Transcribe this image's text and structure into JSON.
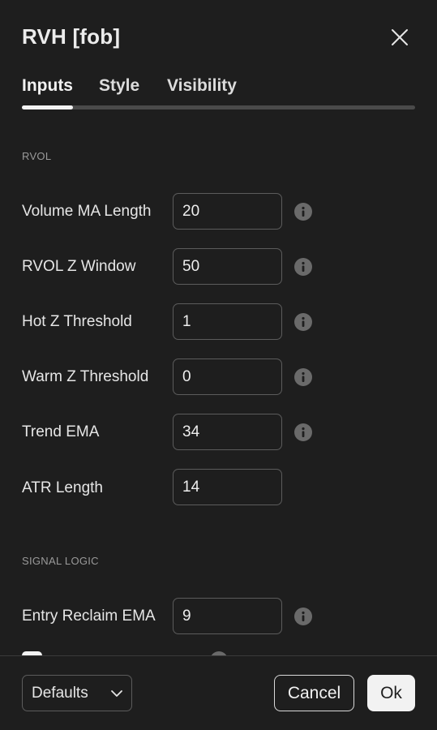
{
  "dialog": {
    "title": "RVH [fob]",
    "close_icon": "close-icon"
  },
  "tabs": [
    {
      "label": "Inputs",
      "active": true
    },
    {
      "label": "Style",
      "active": false
    },
    {
      "label": "Visibility",
      "active": false
    }
  ],
  "sections": [
    {
      "header": "RVOL"
    },
    {
      "header": "SIGNAL LOGIC"
    }
  ],
  "rows": [
    {
      "label": "Volume MA Length",
      "value": "20",
      "info_icon": true
    },
    {
      "label": "RVOL Z Window",
      "value": "50",
      "info_icon": true
    },
    {
      "label": "Hot Z Threshold",
      "value": "1",
      "info_icon": true
    },
    {
      "label": "Warm Z Threshold",
      "value": "0",
      "info_icon": true
    },
    {
      "label": "Trend EMA",
      "value": "34",
      "info_icon": true
    },
    {
      "label": "ATR Length",
      "value": "14",
      "info_icon": false
    },
    {
      "label": "Entry Reclaim EMA",
      "value": "9",
      "info_icon": true
    }
  ],
  "footer": {
    "defaults_label": "Defaults",
    "cancel_label": "Cancel",
    "ok_label": "Ok"
  },
  "colors": {
    "background": "#1e1e1e",
    "text": "#e9e9e9",
    "muted": "#9a9a9a",
    "border": "#5c5c5c",
    "primary_button": "#f2f2f2"
  }
}
